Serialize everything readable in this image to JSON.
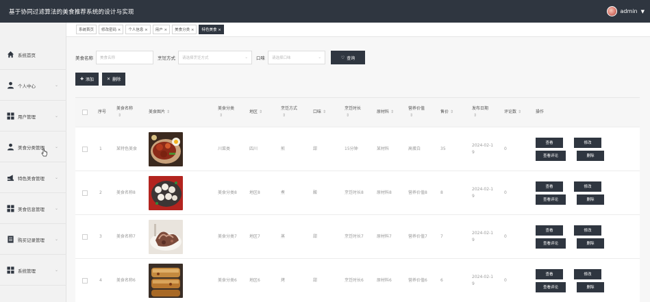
{
  "app": {
    "title": "基于协同过滤算法的美食推荐系统的设计与实现",
    "user": "admin"
  },
  "sidebar": {
    "items": [
      {
        "label": "系统首页",
        "icon": "home-icon",
        "chevron": false
      },
      {
        "label": "个人中心",
        "icon": "user-icon",
        "chevron": true
      },
      {
        "label": "用户管理",
        "icon": "grid-icon",
        "chevron": true
      },
      {
        "label": "美食分类管理",
        "icon": "user-icon",
        "chevron": true
      },
      {
        "label": "特色美食管理",
        "icon": "megaphone-icon",
        "chevron": true
      },
      {
        "label": "美食信息管理",
        "icon": "grid-icon",
        "chevron": true
      },
      {
        "label": "购买记录管理",
        "icon": "document-icon",
        "chevron": true
      },
      {
        "label": "系统管理",
        "icon": "grid-icon",
        "chevron": true
      }
    ]
  },
  "tabs": [
    {
      "label": "系统首页",
      "closable": false,
      "active": false
    },
    {
      "label": "修改密码",
      "closable": true,
      "active": false
    },
    {
      "label": "个人信息",
      "closable": true,
      "active": false
    },
    {
      "label": "用户",
      "closable": true,
      "active": false
    },
    {
      "label": "美食分类",
      "closable": true,
      "active": false
    },
    {
      "label": "特色美食",
      "closable": true,
      "active": true
    }
  ],
  "search": {
    "name_label": "美食名称",
    "name_placeholder": "美食名称",
    "method_label": "烹饪方式",
    "method_placeholder": "请选择烹饪方式",
    "taste_label": "口味",
    "taste_placeholder": "请选择口味",
    "query_label": "查询"
  },
  "actions": {
    "add_label": "添加",
    "delete_label": "删除"
  },
  "table": {
    "headers": {
      "index": "序号",
      "name": "美食名称",
      "image": "美食图片",
      "category": "美食分类",
      "region": "地区",
      "method": "烹饪方式",
      "taste": "口味",
      "duration": "烹饪时长",
      "ingredients": "原材料",
      "nutrition": "营养价值",
      "price": "售价",
      "date": "发布日期",
      "reviews": "评论数",
      "ops": "操作"
    },
    "op_labels": {
      "view": "查看",
      "edit": "修改",
      "view_reviews": "查看评论",
      "delete": "删除"
    },
    "rows": [
      {
        "index": "1",
        "name": "某特色美食",
        "category": "川菜类",
        "region": "四川",
        "method": "煎",
        "taste": "甜",
        "duration": "15分钟",
        "ingredients": "某材料",
        "nutrition": "高蛋白",
        "price": "35",
        "date_line1": "2024-02-1",
        "date_line2": "9",
        "reviews": "0",
        "image": "dish-1"
      },
      {
        "index": "2",
        "name": "美食名称8",
        "category": "美食分类8",
        "region": "地区8",
        "method": "煮",
        "taste": "酸",
        "duration": "烹饪时长8",
        "ingredients": "原材料8",
        "nutrition": "营养价值8",
        "price": "8",
        "date_line1": "2024-02-1",
        "date_line2": "9",
        "reviews": "0",
        "image": "dish-2"
      },
      {
        "index": "3",
        "name": "美食名称7",
        "category": "美食分类7",
        "region": "地区7",
        "method": "蒸",
        "taste": "甜",
        "duration": "烹饪时长7",
        "ingredients": "原材料7",
        "nutrition": "营养价值7",
        "price": "7",
        "date_line1": "2024-02-1",
        "date_line2": "9",
        "reviews": "0",
        "image": "dish-3"
      },
      {
        "index": "4",
        "name": "美食名称6",
        "category": "美食分类6",
        "region": "地区6",
        "method": "烤",
        "taste": "甜",
        "duration": "烹饪时长6",
        "ingredients": "原材料6",
        "nutrition": "营养价值6",
        "price": "6",
        "date_line1": "2024-02-1",
        "date_line2": "9",
        "reviews": "0",
        "image": "dish-4"
      }
    ]
  },
  "colors": {
    "topbar": "#2f3640",
    "button": "#2f3640",
    "sidebar": "#f2f2f2"
  }
}
